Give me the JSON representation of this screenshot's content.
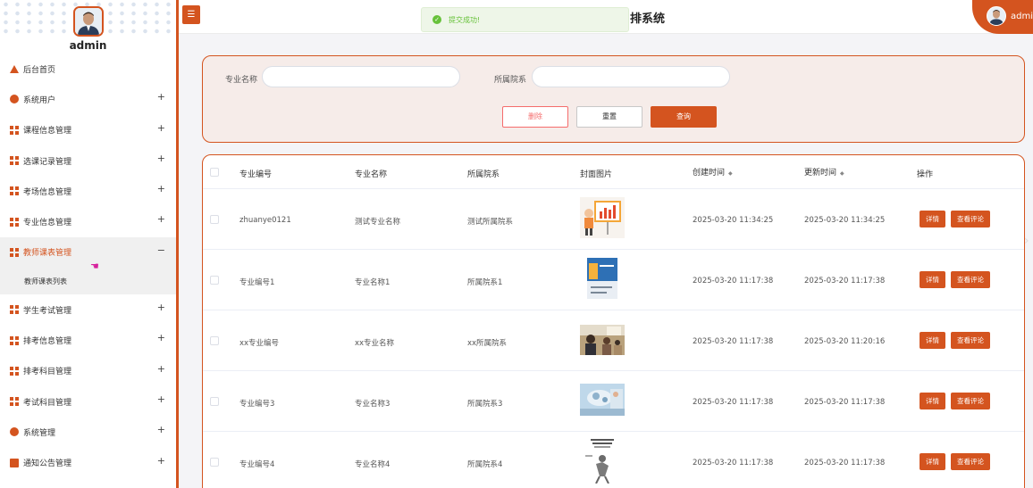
{
  "sidebar": {
    "username": "admin",
    "items": [
      {
        "label": "后台首页",
        "icon": "home-icon",
        "expandable": false
      },
      {
        "label": "系统用户",
        "icon": "user-circle-icon",
        "expandable": true
      },
      {
        "label": "课程信息管理",
        "icon": "grid-icon",
        "expandable": true
      },
      {
        "label": "选课记录管理",
        "icon": "grid-icon",
        "expandable": true
      },
      {
        "label": "考场信息管理",
        "icon": "grid-icon",
        "expandable": true
      },
      {
        "label": "专业信息管理",
        "icon": "grid-icon",
        "expandable": true
      },
      {
        "label": "教师课表管理",
        "icon": "grid-icon",
        "expandable": true,
        "active": true
      },
      {
        "label": "学生考试管理",
        "icon": "grid-icon",
        "expandable": true
      },
      {
        "label": "排考信息管理",
        "icon": "grid-icon",
        "expandable": true
      },
      {
        "label": "排考科目管理",
        "icon": "grid-icon",
        "expandable": true
      },
      {
        "label": "考试科目管理",
        "icon": "grid-icon",
        "expandable": true
      },
      {
        "label": "系统管理",
        "icon": "gear-icon",
        "expandable": true
      },
      {
        "label": "通知公告管理",
        "icon": "document-icon",
        "expandable": true
      }
    ],
    "expanded_sub": "教师课表列表",
    "plus": "+",
    "minus": "−"
  },
  "header": {
    "toggle": "☰",
    "title": "排系统",
    "toast": "提交成功!",
    "username": "admin"
  },
  "search": {
    "major_name_label": "专业名称",
    "major_name_value": "",
    "college_label": "所属院系",
    "college_value": "",
    "delete_label": "删除",
    "reset_label": "重置",
    "query_label": "查询"
  },
  "table": {
    "headers": {
      "code": "专业编号",
      "name": "专业名称",
      "college": "所属院系",
      "cover": "封面图片",
      "created": "创建时间",
      "updated": "更新时间",
      "actions": "操作"
    },
    "sort_icon": "◆",
    "rows": [
      {
        "code": "zhuanye0121",
        "name": "测试专业名称",
        "college": "测试所属院系",
        "created": "2025-03-20 11:34:25",
        "updated": "2025-03-20 11:34:25",
        "cover": "presentation-chart-image"
      },
      {
        "code": "专业编号1",
        "name": "专业名称1",
        "college": "所属院系1",
        "created": "2025-03-20 11:17:38",
        "updated": "2025-03-20 11:17:38",
        "cover": "book-cover-image"
      },
      {
        "code": "xx专业编号",
        "name": "xx专业名称",
        "college": "xx所属院系",
        "created": "2025-03-20 11:17:38",
        "updated": "2025-03-20 11:20:16",
        "cover": "classroom-photo-image"
      },
      {
        "code": "专业编号3",
        "name": "专业名称3",
        "college": "所属院系3",
        "created": "2025-03-20 11:17:38",
        "updated": "2025-03-20 11:17:38",
        "cover": "science-photo-image"
      },
      {
        "code": "专业编号4",
        "name": "专业名称4",
        "college": "所属院系4",
        "created": "2025-03-20 11:17:38",
        "updated": "2025-03-20 11:17:38",
        "cover": "sports-book-cover-image"
      }
    ],
    "detail_label": "详情",
    "review_label": "查看评论"
  },
  "colors": {
    "accent": "#d4541f",
    "success": "#67c23a",
    "danger": "#f56c6c"
  }
}
